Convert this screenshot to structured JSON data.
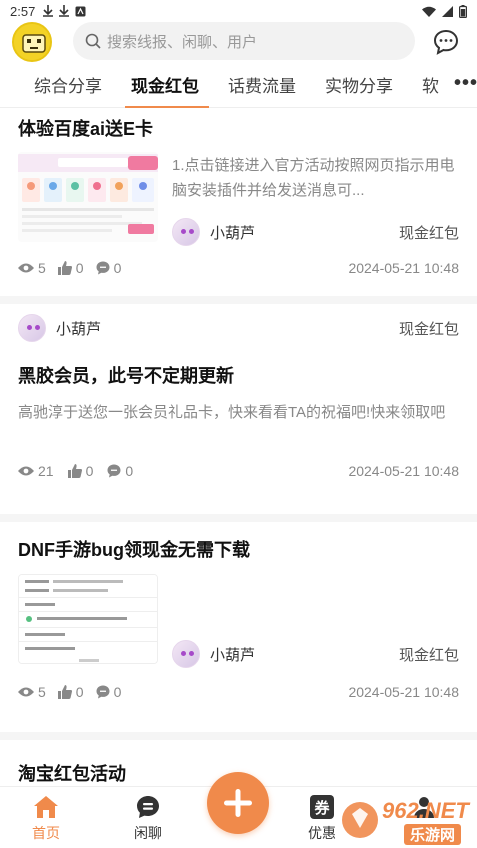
{
  "status_bar": {
    "time": "2:57"
  },
  "search": {
    "placeholder": "搜索线报、闲聊、用户"
  },
  "tabs": [
    {
      "label": "综合分享"
    },
    {
      "label": "现金红包",
      "active": true
    },
    {
      "label": "话费流量"
    },
    {
      "label": "实物分享"
    },
    {
      "label": "软"
    }
  ],
  "posts": [
    {
      "title": "体验百度ai送E卡",
      "excerpt": "1.点击链接进入官方活动按照网页指示用电脑安装插件并给发送消息可...",
      "user": "小葫芦",
      "category": "现金红包",
      "views": "5",
      "likes": "0",
      "comments": "0",
      "date": "2024-05-21 10:48"
    },
    {
      "title": "黑胶会员，此号不定期更新",
      "excerpt": "高驰淳于送您一张会员礼品卡，快来看看TA的祝福吧!快来领取吧",
      "user": "小葫芦",
      "category": "现金红包",
      "views": "21",
      "likes": "0",
      "comments": "0",
      "date": "2024-05-21 10:48"
    },
    {
      "title": "DNF手游bug领现金无需下载",
      "user": "小葫芦",
      "category": "现金红包",
      "views": "5",
      "likes": "0",
      "comments": "0",
      "date": "2024-05-21 10:48"
    },
    {
      "title": "淘宝红包活动"
    }
  ],
  "bottom_nav": {
    "home": "首页",
    "chat": "闲聊",
    "coupon": "优惠",
    "coupon_icon_char": "券",
    "mine": "我的"
  },
  "watermark": {
    "brand": "962.NET",
    "name": "乐游网"
  },
  "colors": {
    "accent": "#f08a4b"
  }
}
